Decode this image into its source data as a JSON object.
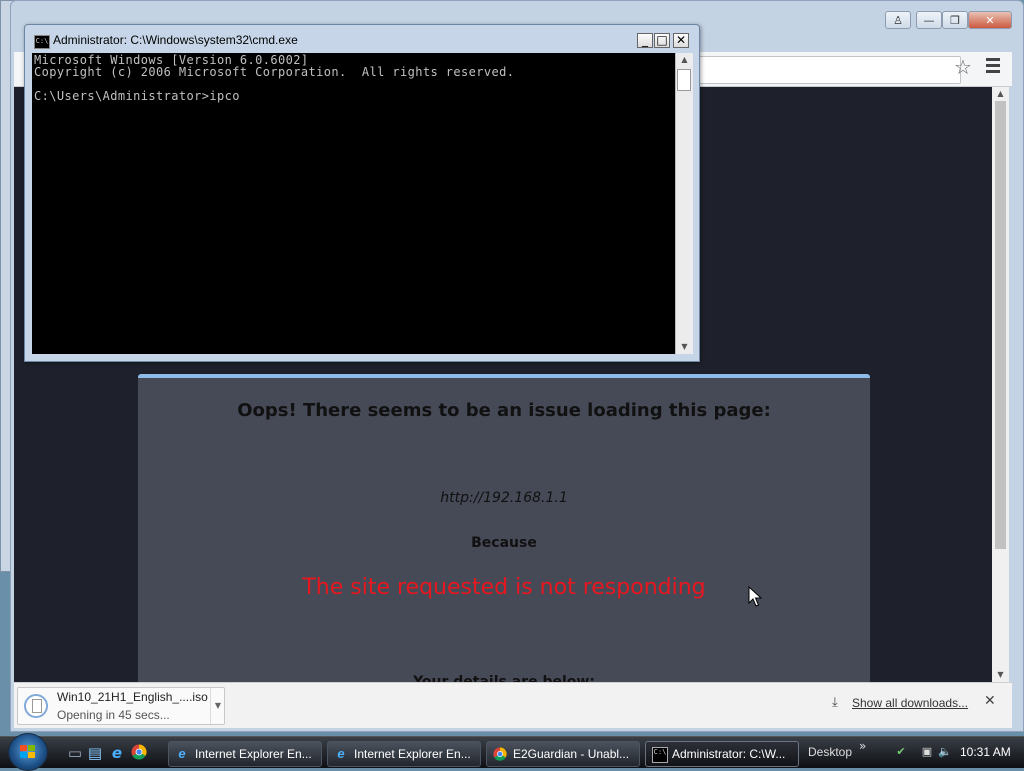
{
  "chrome": {
    "controls": {
      "user": "♙",
      "minimize": "—",
      "maximize": "❐",
      "close": "✕"
    },
    "page": {
      "heading": "Oops! There seems to be an issue loading this page:",
      "url": "http://192.168.1.1",
      "because": "Because",
      "reason": "The site requested is not responding",
      "details": "Your details are below:"
    },
    "downloads": {
      "file_name": "Win10_21H1_English_....iso",
      "status": "Opening in 45 secs...",
      "show_all": "Show all downloads...",
      "close": "✕"
    }
  },
  "cmd": {
    "title": "Administrator: C:\\Windows\\system32\\cmd.exe",
    "icon_text": "C:\\",
    "output": "Microsoft Windows [Version 6.0.6002]\nCopyright (c) 2006 Microsoft Corporation.  All rights reserved.\n\nC:\\Users\\Administrator>ipco",
    "buttons": {
      "minimize": "_",
      "maximize": "□",
      "close": "✕"
    }
  },
  "taskbar": {
    "tasks": [
      {
        "label": "Internet Explorer En..."
      },
      {
        "label": "Internet Explorer En..."
      },
      {
        "label": "E2Guardian - Unabl..."
      },
      {
        "label": "Administrator: C:\\W..."
      }
    ],
    "desktop": "Desktop",
    "desktop_chevron": "»",
    "clock": "10:31 AM"
  },
  "colors": {
    "error_red": "#e8171f",
    "card_bg": "#464a57",
    "card_accent": "#8fbbe8",
    "page_bg": "#1e212b"
  }
}
